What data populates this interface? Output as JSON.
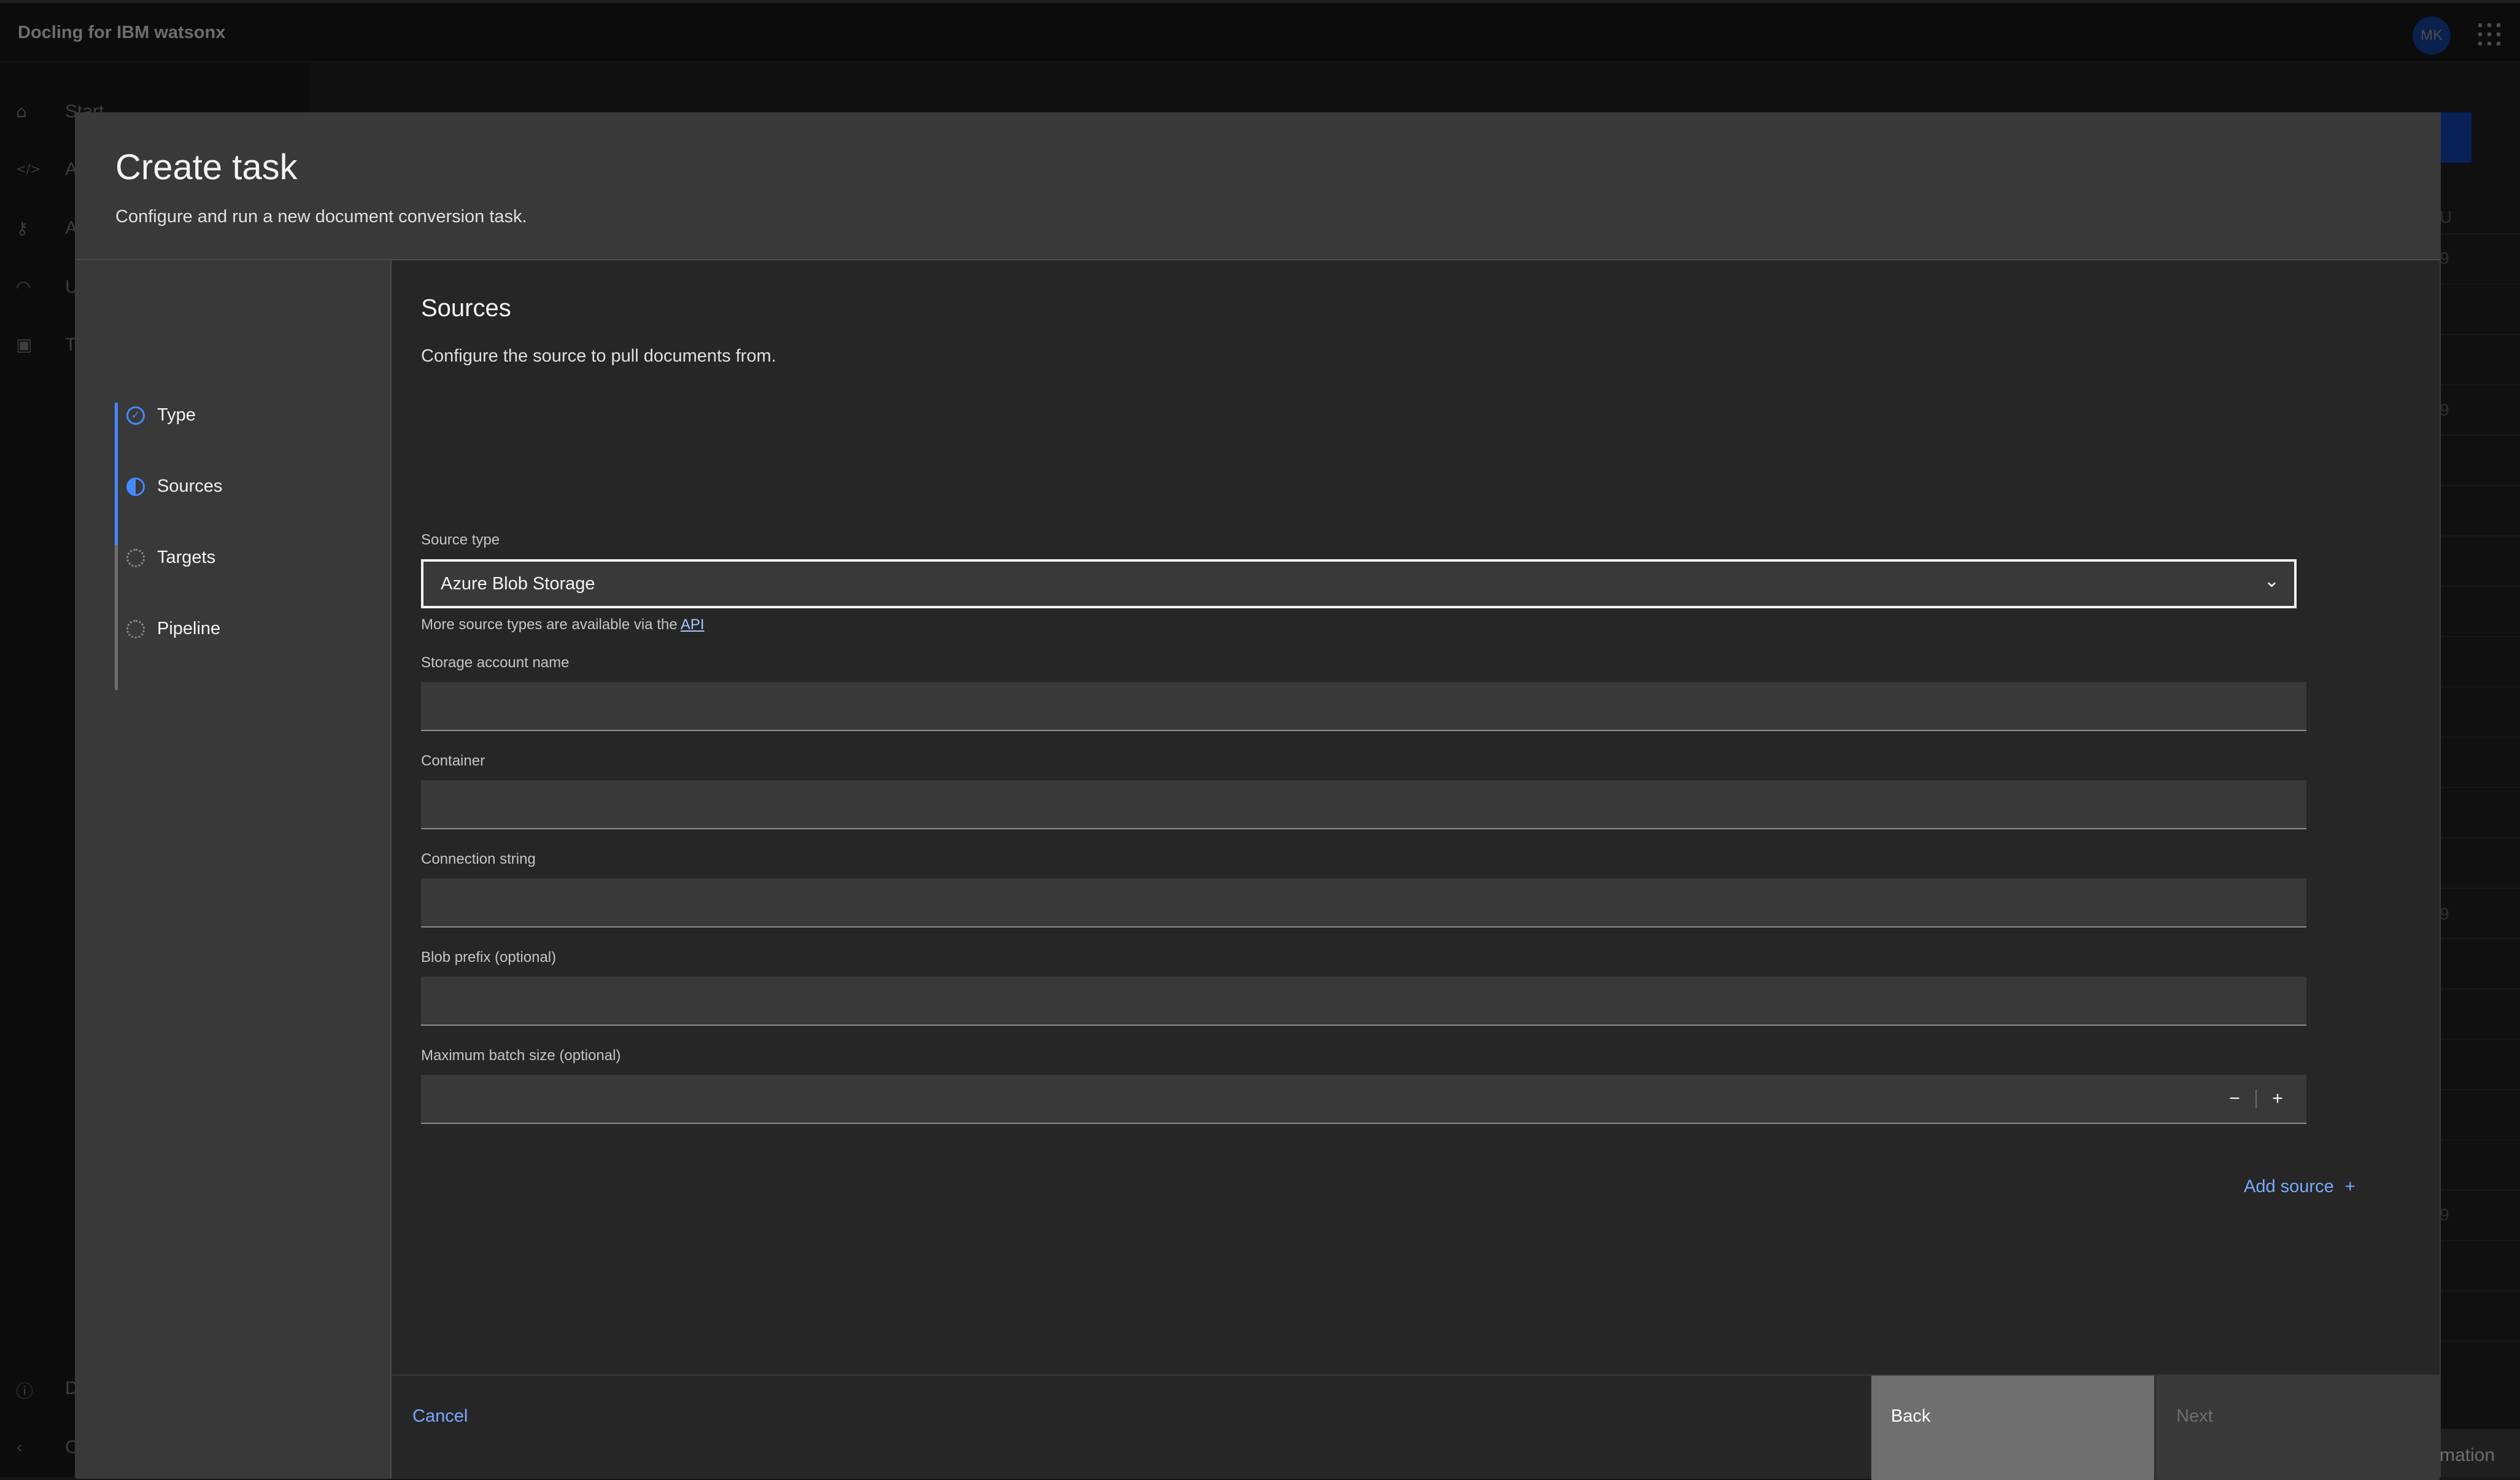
{
  "app": {
    "title": "Docling for IBM watsonx",
    "avatar_initials": "MK"
  },
  "background": {
    "nav_items": [
      {
        "icon": "home-icon",
        "glyph": "⌂",
        "label": "Start"
      },
      {
        "icon": "code-icon",
        "glyph": "</>",
        "label": "A"
      },
      {
        "icon": "key-icon",
        "glyph": "⚷",
        "label": "A"
      },
      {
        "icon": "gauge-icon",
        "glyph": "◠",
        "label": "U"
      },
      {
        "icon": "clipboard-icon",
        "glyph": "▣",
        "label": "T"
      }
    ],
    "bottom_nav": [
      {
        "icon": "info-icon",
        "glyph": "ⓘ",
        "label": "D"
      },
      {
        "icon": "chevron-left-icon",
        "glyph": "‹",
        "label": "C"
      }
    ],
    "right_fragments": [
      "U",
      "9",
      "9",
      "9",
      "9"
    ],
    "footer_fragment": "mation"
  },
  "modal": {
    "title": "Create task",
    "subtitle": "Configure and run a new document conversion task.",
    "steps": [
      {
        "label": "Type",
        "state": "complete"
      },
      {
        "label": "Sources",
        "state": "current"
      },
      {
        "label": "Targets",
        "state": "incomplete"
      },
      {
        "label": "Pipeline",
        "state": "incomplete"
      }
    ],
    "form": {
      "title": "Sources",
      "description": "Configure the source to pull documents from.",
      "source_type": {
        "label": "Source type",
        "value": "Azure Blob Storage",
        "helper_prefix": "More source types are available via the",
        "helper_link": "API"
      },
      "fields": {
        "storage_account": {
          "label": "Storage account name",
          "value": ""
        },
        "container": {
          "label": "Container",
          "value": ""
        },
        "connection_string": {
          "label": "Connection string",
          "value": ""
        },
        "blob_prefix": {
          "label": "Blob prefix (optional)",
          "value": ""
        },
        "max_batch": {
          "label": "Maximum batch size (optional)",
          "value": ""
        }
      },
      "stepper": {
        "minus": "−",
        "plus": "+"
      },
      "add_source": "Add source",
      "add_source_icon": "+"
    },
    "footer": {
      "cancel": "Cancel",
      "back": "Back",
      "next": "Next"
    }
  }
}
